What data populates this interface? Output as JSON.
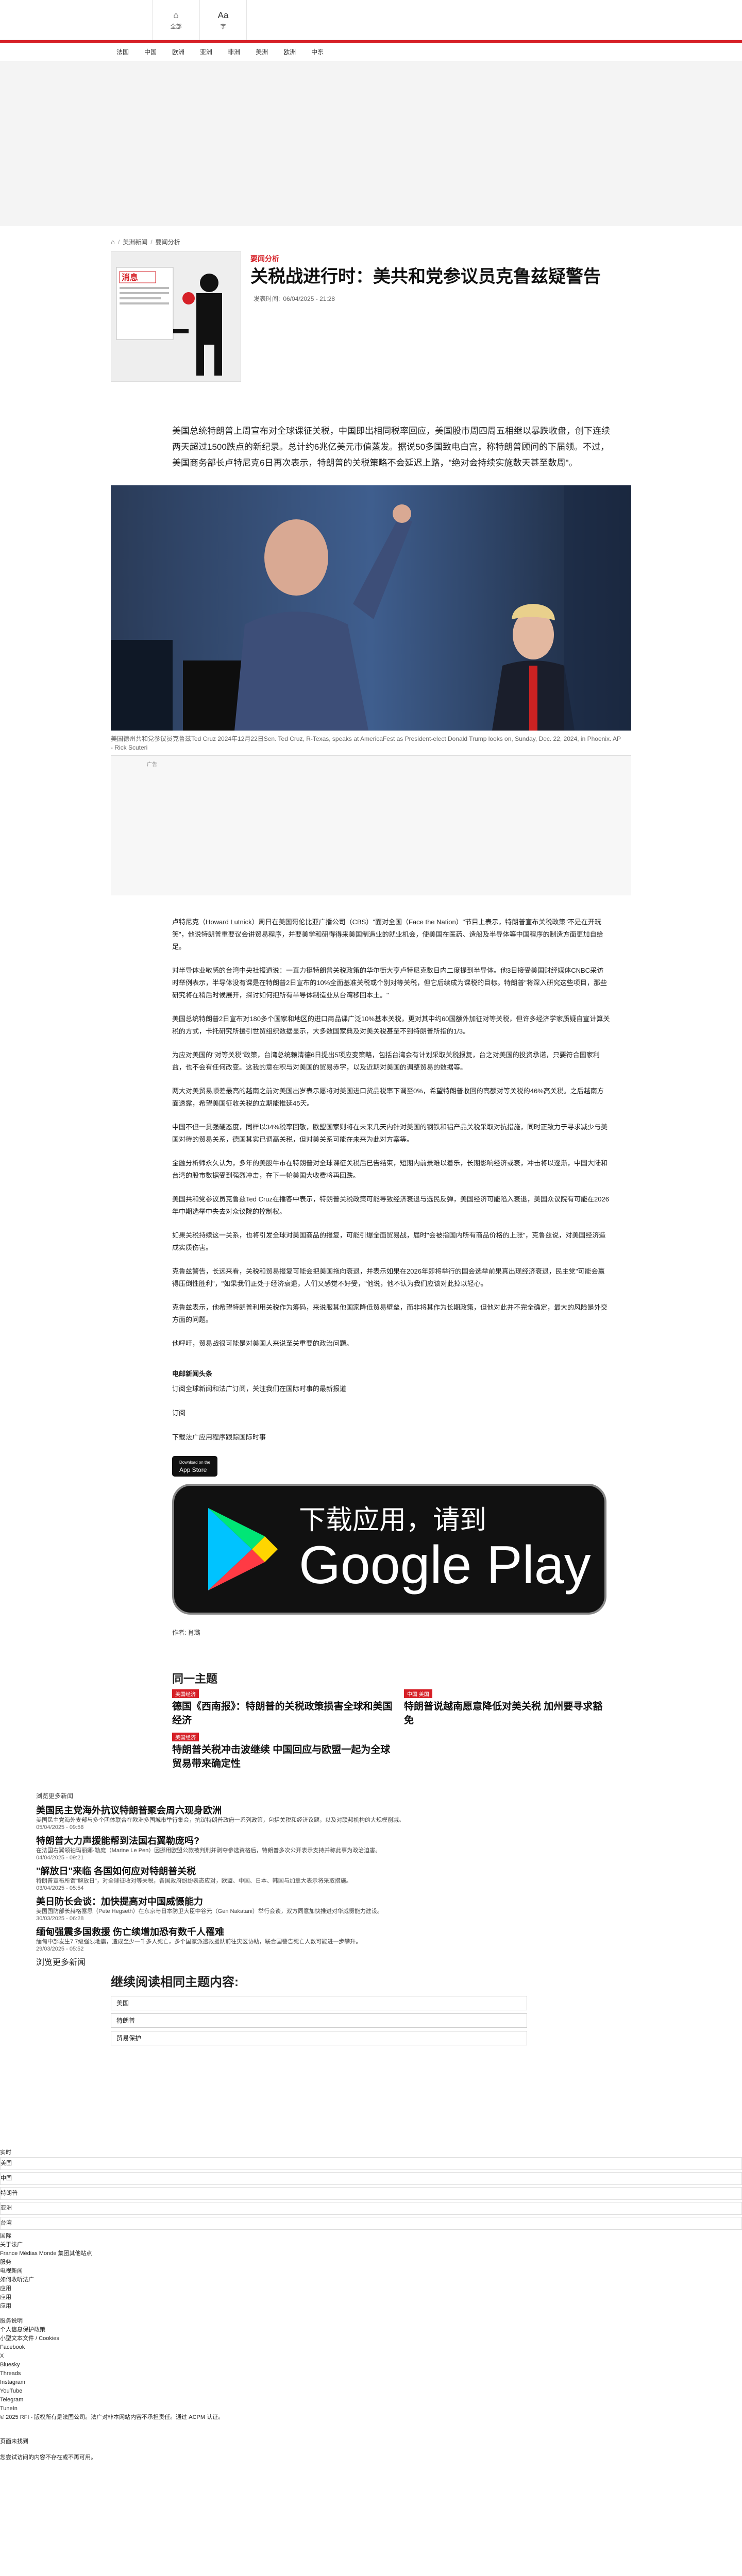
{
  "topbar": {
    "tool1_label": "全部",
    "tool2_label": "字"
  },
  "nav": [
    "法国",
    "中国",
    "欧洲",
    "亚洲",
    "非洲",
    "美洲",
    "欧洲",
    "中东"
  ],
  "breadcrumb": {
    "item1": "美洲新闻",
    "item2": "要闻分析"
  },
  "article": {
    "kicker": "要闻分析",
    "title": "关税战进行时：美共和党参议员克鲁兹疑警告",
    "date_label": "发表时间:",
    "date_value": "06/04/2025 - 21:28",
    "lead": "美国总统特朗普上周宣布对全球课征关税，中国即出相同税率回应，美国股市周四周五相继以暴跌收盘，创下连续两天超过1500跌点的新纪录。总计约6兆亿美元市值蒸发。据说50多国致电白宫，称特朗普顾问的下届领。不过，美国商务部长卢特尼克6日再次表示，特朗普的关税策略不会延迟上路，\"绝对会持续实施数天甚至数周\"。",
    "image_caption": "美国德州共和党参议员克鲁兹Ted Cruz 2024年12月22日Sen. Ted Cruz, R-Texas, speaks at AmericaFest as President-elect Donald Trump looks on, Sunday, Dec. 22, 2024, in Phoenix. AP - Rick Scuteri",
    "ad_label": "广告",
    "paragraphs": [
      "卢特尼克（Howard Lutnick）周日在美国哥伦比亚广播公司（CBS）\"面对全国（Face the Nation）\"节目上表示，特朗普宣布关税政策\"不是在开玩笑\"，他说特朗普重要议会讲贸易程序，并要美学和研得得来美国制造业的就业机会，使美国在医药、造船及半导体等中国程序的制造方面更加自给足。",
      "对半导体业敏感的台湾中央社报道说：一直力挺特朗普关税政策的华尔街大亨卢特尼克数日内二度提到半导体。他3日接受美国财经媒体CNBC采访时举例表示，半导体没有课是在特朗普2日宣布的10%全面基准关税或个别对等关税，但它后续成为课税的目标。特朗普\"将深入研究这些项目，那些研究将在稍后时候展开，探讨如何把所有半导体制造业从台湾移回本土。\"",
      "美国总统特朗普2日宣布对180多个国家和地区的进口商品课广泛10%基本关税，更对其中约60国额外加征对等关税，但许多经济学家质疑自宣计算关税的方式，卡托研究所援引世贸组织数据显示，大多数国家典及对美关税甚至不到特朗普所指的1/3。",
      "为应对美国的\"对等关税\"政策，台湾总统赖清德6日提出5项应变策略，包括台湾会有计划采取关税报复，台之对美国的投资承诺，只要符合国家利益，也不会有任何改变。这我的意在积与对美国的贸易赤字，以及近期对美国的调整贸易的数据等。",
      "两大对美贸易顺差最高的越南之前对美国出岁表示愿将对美国进口货品税率下调至0%，希望特朗普收回的高额对等关税的46%高关税。之后越南方面透露，希望美国征收关税的立期能推延45天。",
      "中国不但一贯强硬态度，同样以34%税率回敬，欧盟国家则将在未来几天内针对美国的钢铁和铝产品关税采取对抗措施，同时正致力于寻求减少与美国对待的贸易关系，德国其实已调高关税，但对美关系可能在未来为此对方案等。",
      "金融分析师永久认为，多年的美股牛市在特朗普对全球课征关税后已告结束，短期内前景难以着乐，长期影响经济或衰，冲击将以逐渐，中国大陆和台湾的股市数据受到强烈冲击，在下一轮美国大收费将再回跌。",
      "美国共和党参议员克鲁兹Ted Cruz在播客中表示，特朗普关税政策可能导致经济衰退与选民反弹，美国经济可能陷入衰退，美国众议院有可能在2026年中期选举中失去对众议院的控制权。",
      "如果关税持续这一关系，也将引发全球对美国商品的报复，可能引爆全面贸易战，届时\"会被指国内所有商品价格的上涨\"，克鲁兹说，对美国经济造成实质伤害。",
      "克鲁兹警告，长远来看，关税和贸易报复可能会把美国拖向衰退，并表示如果在2026年即将举行的国会选举前果真出现经济衰退，民主党\"可能会赢得压倒性胜利\"，\"如果我们正处于经济衰退，人们又感觉不好受，\"他说，他不认为我们应该对此掉以轻心。",
      "克鲁兹表示，他希望特朗普利用关税作为筹码，来说服其他国家降低贸易壁垒，而非将其作为长期政策，但他对此并不完全确定，最大的风险是外交方面的问题。",
      "他呼吁，贸易战很可能是对美国人来说至关重要的政治问题。"
    ],
    "follow_title": "电邮新闻头条",
    "follow_text": "订阅全球新闻和法广订阅，关注我们在国际时事的最新报道",
    "follow_cta": "订阅",
    "download_text": "下载法广应用程序跟踪国际时事",
    "appstore_small": "Download on the",
    "appstore_big": "App Store",
    "gplay_line1": "下载应用，请到",
    "gplay_line2": "Google Play",
    "author": "作者: 肖璐"
  },
  "related": {
    "title": "同一主题",
    "items": [
      {
        "tag": "美国经济",
        "title": "德国《西南报》：特朗普的关税政策损害全球和美国经济"
      },
      {
        "tag": "中国 美国",
        "title": "特朗普说越南愿意降低对美关税 加州要寻求豁免"
      },
      {
        "tag": "美国经济",
        "title": "特朗普关税冲击波继续 中国回应与欧盟一起为全球贸易带来确定性"
      }
    ]
  },
  "more": {
    "tabs": "浏览更多新闻",
    "items": [
      {
        "title": "美国民主党海外抗议特朗普聚会周六现身欧洲",
        "summary": "美国民主党海外支部与多个团体联合在欧洲多国城市举行集会，抗议特朗普政府一系列政策，包括关税和经济议题，以及对联邦机构的大规模削减。",
        "date": "05/04/2025 - 09:58"
      },
      {
        "title": "特朗普大力声援能帮到法国右翼勒庞吗?",
        "summary": "在法国右翼领袖玛丽娜·勒庞（Marine Le Pen）因挪用欧盟公款被判刑并剥夺参选资格后，特朗普多次公开表示支持并称此事为政治迫害。",
        "date": "04/04/2025 - 09:21"
      },
      {
        "title": "\"解放日\"来临 各国如何应对特朗普关税",
        "summary": "特朗普宣布所谓\"解放日\"，对全球征收对等关税，各国政府纷纷表态应对，欧盟、中国、日本、韩国与加拿大表示将采取措施。",
        "date": "03/04/2025 - 05:54"
      },
      {
        "title": "美日防长会谈：加快提高对中国威慑能力",
        "summary": "美国国防部长赫格塞思（Pete Hegseth）在东京与日本防卫大臣中谷元（Gen Nakatani）举行会谈，双方同意加快推进对华威慑能力建设。",
        "date": "30/03/2025 - 06:28"
      },
      {
        "title": "缅甸强震多国救援 伤亡续增加恐有数千人罹难",
        "summary": "缅甸中部发生7.7级强烈地震，造成至少一千多人死亡，多个国家派遣救援队前往灾区协助，联合国警告死亡人数可能进一步攀升。",
        "date": "29/03/2025 - 05:52"
      }
    ],
    "more_link": "浏览更多新闻"
  },
  "continue": {
    "title": "继续阅读相同主题内容:",
    "items": [
      "美国",
      "特朗普",
      "贸易保护"
    ]
  },
  "footer": {
    "heading": "实时",
    "rows": [
      "美国",
      "中国",
      "特朗普",
      "亚洲",
      "台湾"
    ],
    "lines": [
      "国际",
      "关于法广",
      "France Médias Monde 集团其他站点",
      "服务",
      "电视新闻",
      "如何收听法广",
      "应用",
      "应用",
      "应用",
      "服务说明",
      "个人信息保护政策",
      "小型文本文件 / Cookies",
      "Facebook",
      "X",
      "Bluesky",
      "Threads",
      "Instagram",
      "YouTube",
      "Telegram",
      "TuneIn",
      "© 2025 RFI - 版权所有是法国公司。法广对非本网站内容不承担责任。通过 ACPM 认证。"
    ],
    "bottom1": "页面未找到",
    "bottom2": "您尝试访问的内容不存在或不再可用。"
  }
}
